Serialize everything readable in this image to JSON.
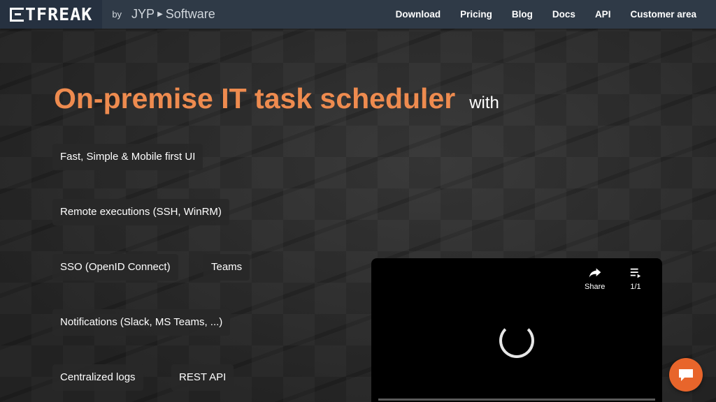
{
  "header": {
    "logo_text": "TFREAK",
    "by_label": "by",
    "company_name": "JYP",
    "company_suffix": "Software",
    "nav": [
      {
        "label": "Download"
      },
      {
        "label": "Pricing"
      },
      {
        "label": "Blog"
      },
      {
        "label": "Docs"
      },
      {
        "label": "API"
      },
      {
        "label": "Customer area"
      }
    ]
  },
  "hero": {
    "title": "On-premise IT task scheduler",
    "with_label": "with",
    "features": [
      "Fast, Simple & Mobile first UI",
      "Remote executions (SSH, WinRM)",
      "SSO (OpenID Connect)",
      "Teams",
      "Notifications (Slack, MS Teams, ...)",
      "Centralized logs",
      "REST API"
    ]
  },
  "video": {
    "share_label": "Share",
    "playlist_label": "1/1"
  },
  "colors": {
    "accent": "#ee8b4f",
    "header_bg": "#2f3a47",
    "chat_button": "#e8652b"
  },
  "icons": [
    "share-icon",
    "playlist-icon",
    "loading-spinner-icon",
    "chat-icon",
    "logo-icon",
    "play-arrow-icon"
  ]
}
